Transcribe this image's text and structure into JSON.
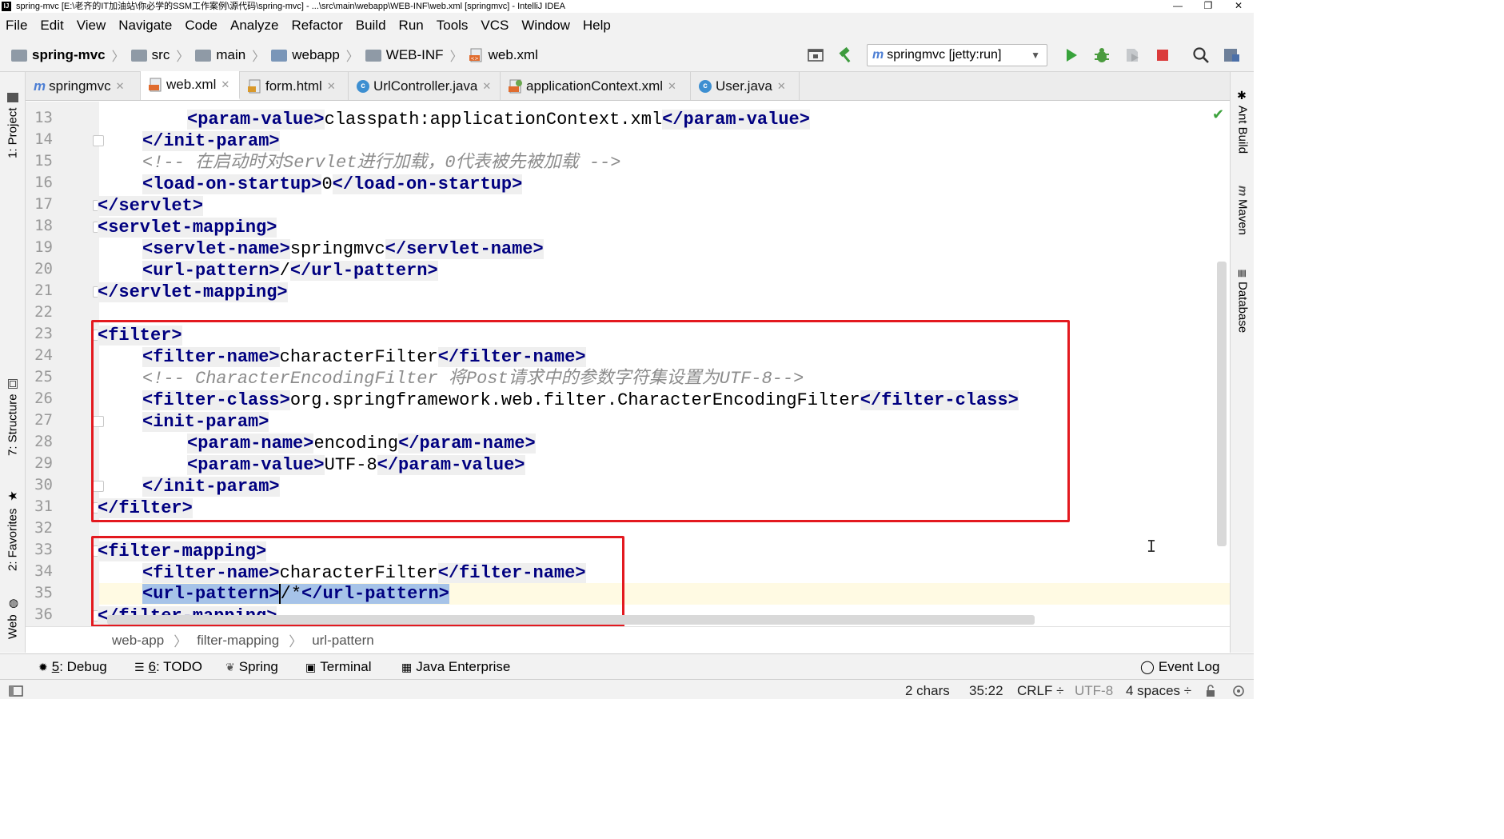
{
  "window": {
    "title": "spring-mvc [E:\\老齐的IT加油站\\你必学的SSM工作案例\\源代码\\spring-mvc] - ...\\src\\main\\webapp\\WEB-INF\\web.xml [springmvc] - IntelliJ IDEA",
    "minimize": "—",
    "restore": "❐",
    "close": "✕"
  },
  "menu": [
    "File",
    "Edit",
    "View",
    "Navigate",
    "Code",
    "Analyze",
    "Refactor",
    "Build",
    "Run",
    "Tools",
    "VCS",
    "Window",
    "Help"
  ],
  "nav": {
    "crumbs": [
      "spring-mvc",
      "src",
      "main",
      "webapp",
      "WEB-INF",
      "web.xml"
    ],
    "run_config": "springmvc [jetty:run]"
  },
  "tabs": [
    {
      "label": "springmvc",
      "icon": "maven-icon"
    },
    {
      "label": "web.xml",
      "icon": "xml-icon",
      "active": true
    },
    {
      "label": "form.html",
      "icon": "html-icon"
    },
    {
      "label": "UrlController.java",
      "icon": "class-icon"
    },
    {
      "label": "applicationContext.xml",
      "icon": "spring-xml-icon"
    },
    {
      "label": "User.java",
      "icon": "class-icon"
    }
  ],
  "left_tools": [
    "1: Project",
    "7: Structure",
    "2: Favorites",
    "Web"
  ],
  "right_tools": [
    "Ant Build",
    "Maven",
    "Database"
  ],
  "editor": {
    "line_numbers": [
      "13",
      "14",
      "15",
      "16",
      "17",
      "18",
      "19",
      "20",
      "21",
      "22",
      "23",
      "24",
      "25",
      "26",
      "27",
      "28",
      "29",
      "30",
      "31",
      "32",
      "33",
      "34",
      "35",
      "36"
    ],
    "l13": {
      "open": "<param-value>",
      "text": "classpath:applicationContext.xml",
      "close": "</param-value>"
    },
    "l14": "</init-param>",
    "l15": "<!-- 在启动时对Servlet进行加载，0代表被先被加载 -->",
    "l16": {
      "open": "<load-on-startup>",
      "text": "0",
      "close": "</load-on-startup>"
    },
    "l17": "</servlet>",
    "l18": "<servlet-mapping>",
    "l19": {
      "open": "<servlet-name>",
      "text": "springmvc",
      "close": "</servlet-name>"
    },
    "l20": {
      "open": "<url-pattern>",
      "text": "/",
      "close": "</url-pattern>"
    },
    "l21": "</servlet-mapping>",
    "l23": "<filter>",
    "l24": {
      "open": "<filter-name>",
      "text": "characterFilter",
      "close": "</filter-name>"
    },
    "l25": "<!-- CharacterEncodingFilter 将Post请求中的参数字符集设置为UTF-8-->",
    "l26": {
      "open": "<filter-class>",
      "text": "org.springframework.web.filter.CharacterEncodingFilter",
      "close": "</filter-class>"
    },
    "l27": "<init-param>",
    "l28": {
      "open": "<param-name>",
      "text": "encoding",
      "close": "</param-name>"
    },
    "l29": {
      "open": "<param-value>",
      "text": "UTF-8",
      "close": "</param-value>"
    },
    "l30": "</init-param>",
    "l31": "</filter>",
    "l33": "<filter-mapping>",
    "l34": {
      "open": "<filter-name>",
      "text": "characterFilter",
      "close": "</filter-name>"
    },
    "l35": {
      "open": "<url-pattern>",
      "text": "/*",
      "close": "</url-pattern>"
    },
    "l36": "</filter-mapping>"
  },
  "editor_breadcrumb": [
    "web-app",
    "filter-mapping",
    "url-pattern"
  ],
  "tool_windows": [
    {
      "num": "5",
      "label": ": Debug"
    },
    {
      "num": "6",
      "label": ": TODO"
    },
    {
      "num": "",
      "label": "Spring"
    },
    {
      "num": "",
      "label": "Terminal"
    },
    {
      "num": "",
      "label": "Java Enterprise"
    }
  ],
  "event_log": "Event Log",
  "status": {
    "selection": "2 chars",
    "position": "35:22",
    "line_sep": "CRLF ÷",
    "encoding": "UTF-8",
    "indent": "4 spaces ÷"
  },
  "colors": {
    "tag": "#000080",
    "comment": "#8c8c8c",
    "highlight_box": "#e3191f",
    "selection": "#a6c3e8",
    "caret_line": "#fffae3"
  }
}
